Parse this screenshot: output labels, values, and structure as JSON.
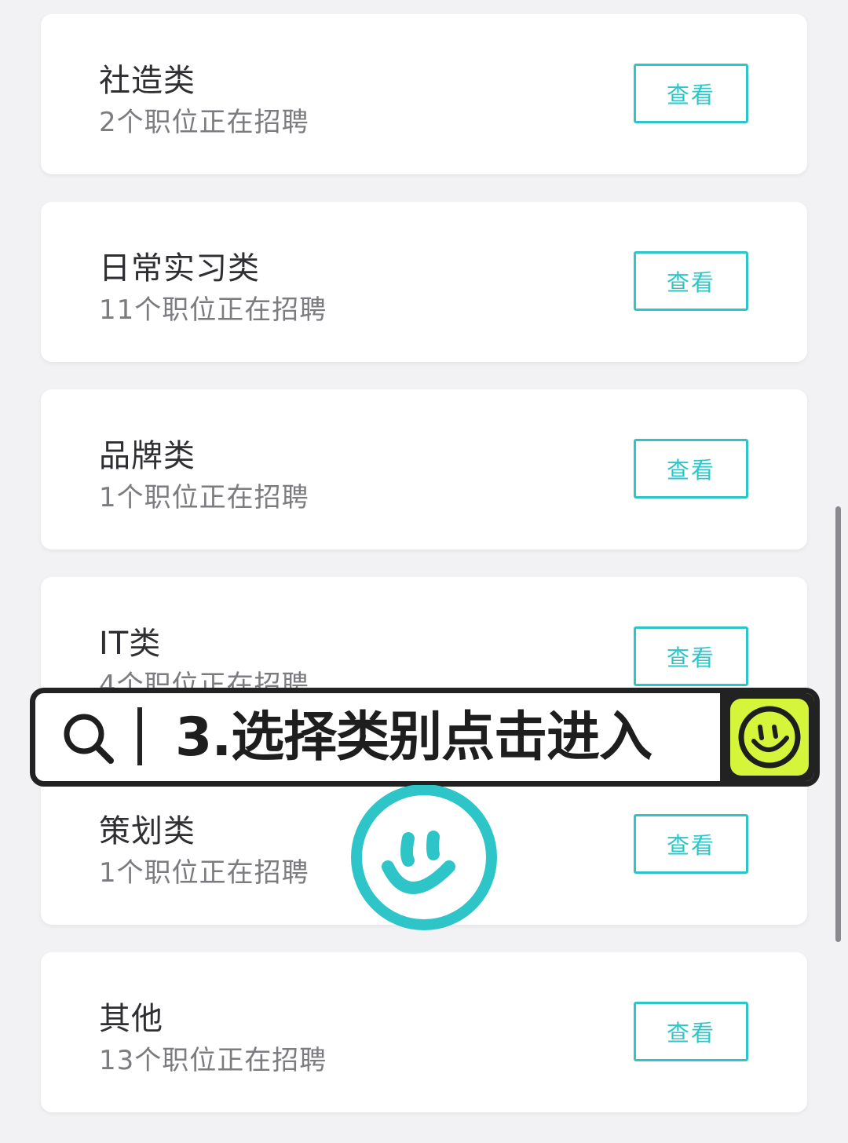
{
  "categories": [
    {
      "title": "社造类",
      "count": "2个职位正在招聘",
      "button": "查看"
    },
    {
      "title": "日常实习类",
      "count": "11个职位正在招聘",
      "button": "查看"
    },
    {
      "title": "品牌类",
      "count": "1个职位正在招聘",
      "button": "查看"
    },
    {
      "title": "IT类",
      "count": "4个职位正在招聘",
      "button": "查看"
    },
    {
      "title": "策划类",
      "count": "1个职位正在招聘",
      "button": "查看"
    },
    {
      "title": "其他",
      "count": "13个职位正在招聘",
      "button": "查看"
    }
  ],
  "overlay": {
    "caption": "3.选择类别点击进入",
    "icons": [
      "search-icon",
      "smiley-icon"
    ],
    "accent": "#d4f53a"
  },
  "sticker": {
    "icon": "smiley-sticker-icon",
    "color": "#2ec5c8"
  },
  "colors": {
    "accent": "#2ec5c8",
    "background": "#f2f2f4"
  }
}
